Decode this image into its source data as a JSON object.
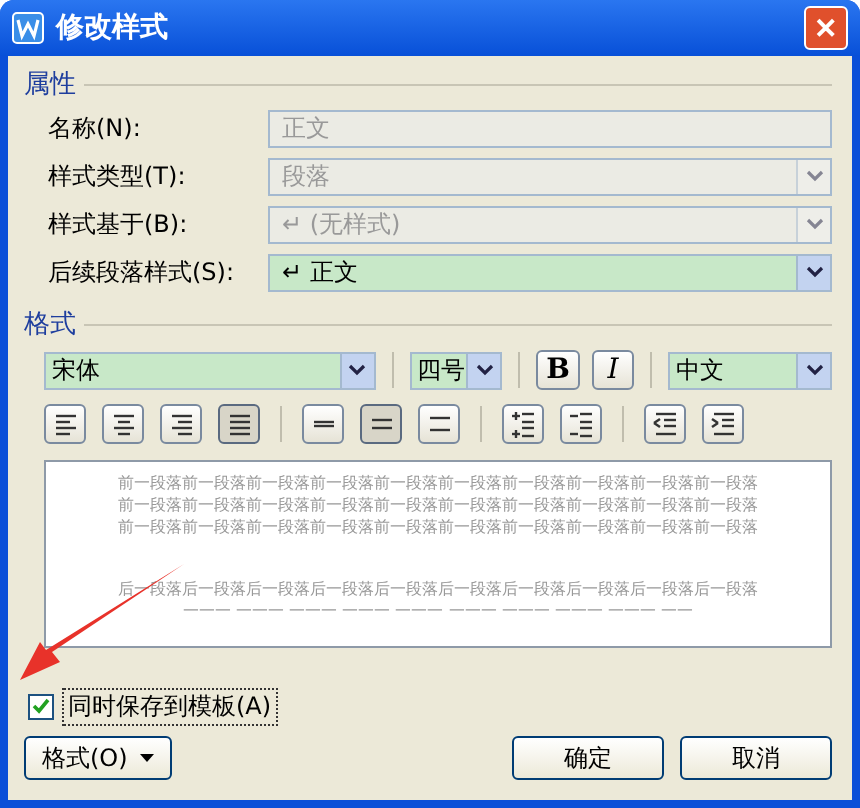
{
  "window": {
    "title": "修改样式",
    "close": "✕"
  },
  "properties": {
    "heading": "属性",
    "fields": [
      {
        "label": "名称(N):",
        "kind": "text",
        "value": "正文",
        "disabled": true
      },
      {
        "label": "样式类型(T):",
        "kind": "select",
        "value": "段落",
        "disabled": true
      },
      {
        "label": "样式基于(B):",
        "kind": "select",
        "value": "↵ (无样式)",
        "disabled": true
      },
      {
        "label": "后续段落样式(S):",
        "kind": "select",
        "value": "↵ 正文",
        "disabled": false
      }
    ]
  },
  "format": {
    "heading": "格式",
    "font": "宋体",
    "size": "四号",
    "bold": "B",
    "italic": "I",
    "language": "中文",
    "tools": [
      {
        "kind": "align-left",
        "selected": false
      },
      {
        "kind": "align-center",
        "selected": false
      },
      {
        "kind": "align-right",
        "selected": false
      },
      {
        "kind": "align-justify",
        "selected": true
      },
      {
        "kind": "spacing-single",
        "selected": false
      },
      {
        "kind": "spacing-half",
        "selected": true
      },
      {
        "kind": "spacing-double",
        "selected": false
      },
      {
        "kind": "space-increase",
        "selected": false
      },
      {
        "kind": "space-decrease",
        "selected": false
      },
      {
        "kind": "indent-decrease",
        "selected": false
      },
      {
        "kind": "indent-increase",
        "selected": false
      }
    ]
  },
  "preview": {
    "before": [
      "前一段落前一段落前一段落前一段落前一段落前一段落前一段落前一段落前一段落前一段落",
      "前一段落前一段落前一段落前一段落前一段落前一段落前一段落前一段落前一段落前一段落",
      "前一段落前一段落前一段落前一段落前一段落前一段落前一段落前一段落前一段落前一段落"
    ],
    "after": [
      "后一段落后一段落后一段落后一段落后一段落后一段落后一段落后一段落后一段落后一段落",
      "一一一 一一一 一一一 一一一 一一一 一一一 一一一 一一一 一一一 一一"
    ]
  },
  "save_to_template": {
    "label": "同时保存到模板(A)",
    "checked": true
  },
  "buttons": {
    "format": "格式(O)",
    "ok": "确定",
    "cancel": "取消"
  }
}
